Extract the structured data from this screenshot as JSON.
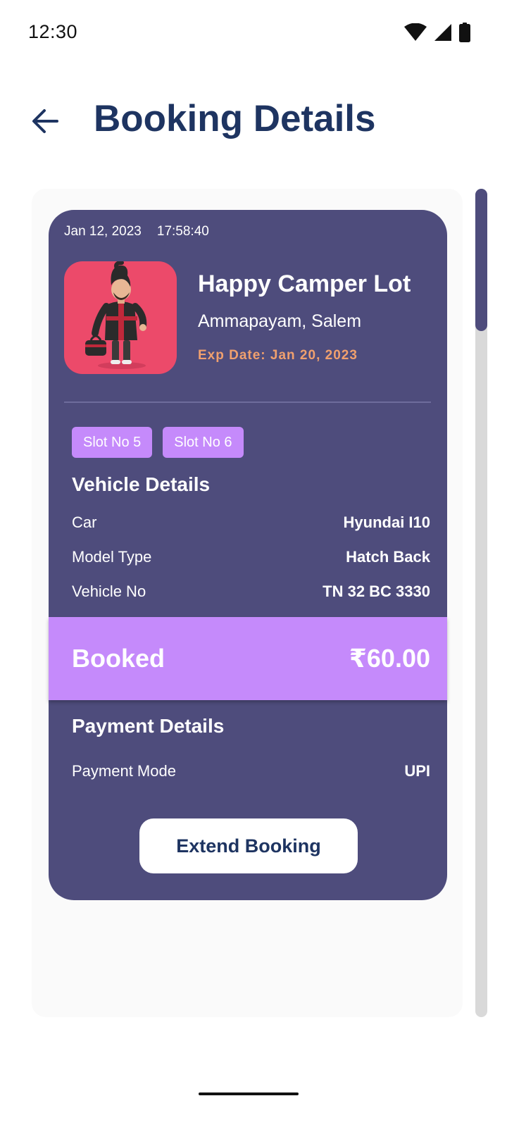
{
  "status_bar": {
    "time": "12:30",
    "icons": [
      "wifi-icon",
      "signal-icon",
      "battery-icon"
    ]
  },
  "header": {
    "back_icon": "arrow-left-icon",
    "title": "Booking Details"
  },
  "booking": {
    "date": "Jan 12, 2023",
    "time": "17:58:40",
    "lot_name": "Happy Camper Lot",
    "location": "Ammapayam, Salem",
    "exp_date": "Exp Date: Jan 20, 2023",
    "slots": [
      "Slot No 5",
      "Slot No 6"
    ],
    "vehicle": {
      "title": "Vehicle Details",
      "rows": [
        {
          "label": "Car",
          "value": "Hyundai I10"
        },
        {
          "label": "Model Type",
          "value": "Hatch Back"
        },
        {
          "label": "Vehicle No",
          "value": "TN 32 BC 3330"
        }
      ]
    },
    "status": {
      "label": "Booked",
      "amount": "₹60.00"
    },
    "payment": {
      "title": "Payment Details",
      "rows": [
        {
          "label": "Payment Mode",
          "value": "UPI"
        }
      ]
    },
    "extend_label": "Extend Booking"
  },
  "colors": {
    "card": "#4e4c7c",
    "accent": "#c58afb",
    "title": "#1e3461",
    "exp_date": "#f0a06e",
    "image_bg": "#ec4a6a"
  }
}
